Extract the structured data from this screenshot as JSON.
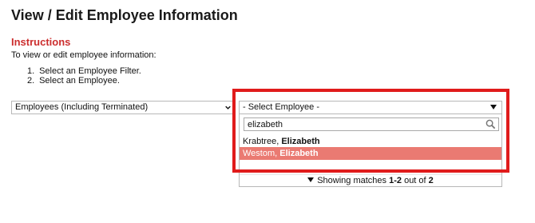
{
  "page": {
    "title": "View / Edit Employee Information"
  },
  "instructions": {
    "heading": "Instructions",
    "text": "To view or edit employee information:",
    "steps": [
      {
        "num": "1.",
        "text": "Select an Employee Filter."
      },
      {
        "num": "2.",
        "text": "Select an Employee."
      }
    ]
  },
  "filter": {
    "selected": "Employees (Including Terminated)",
    "icon": "chevron-down-icon"
  },
  "employee_select": {
    "selected": "- Select Employee -",
    "icon": "triangle-down-icon",
    "search": {
      "value": "elizabeth",
      "icon": "search-icon"
    },
    "options": [
      {
        "last": "Krabtree, ",
        "first": "Elizabeth",
        "highlighted": false
      },
      {
        "last": "Westom, ",
        "first": "Elizabeth",
        "highlighted": true
      }
    ],
    "status": {
      "prefix": "Showing matches ",
      "range": "1-2",
      "middle": " out of ",
      "total": "2"
    }
  },
  "colors": {
    "heading_red": "#cc2e2e",
    "highlight_box": "#e01b1b",
    "selected_option": "#ea7a72"
  }
}
